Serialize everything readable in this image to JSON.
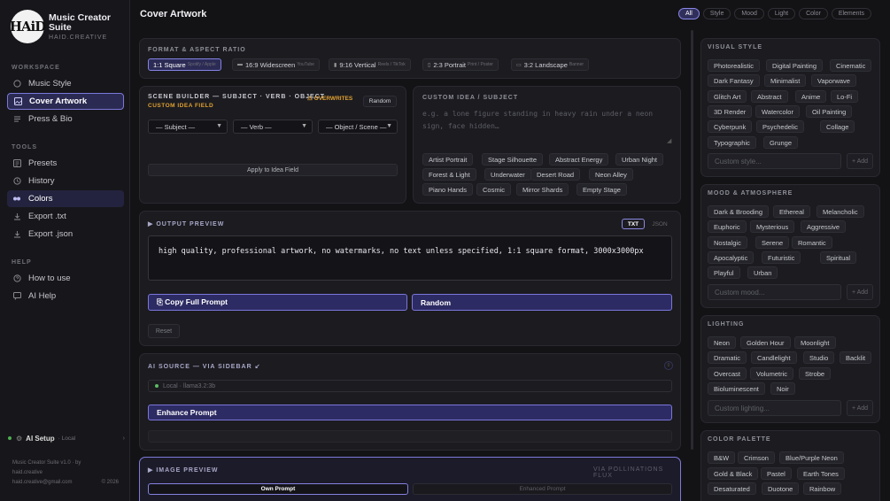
{
  "app": {
    "title": "Music Creator Suite",
    "sub": "HAID.CREATIVE",
    "logo_text": "HAiD"
  },
  "sidebar": {
    "workspace_label": "WORKSPACE",
    "workspace": [
      {
        "label": "Music Style",
        "icon": "circle-icon"
      },
      {
        "label": "Cover Artwork",
        "icon": "image-icon"
      },
      {
        "label": "Press & Bio",
        "icon": "lines-icon"
      }
    ],
    "tools_label": "TOOLS",
    "tools": [
      {
        "label": "Presets",
        "icon": "preset-icon"
      },
      {
        "label": "History",
        "icon": "clock-icon"
      },
      {
        "label": "Colors",
        "icon": "palette-icon"
      },
      {
        "label": "Export .txt",
        "icon": "download-icon"
      },
      {
        "label": "Export .json",
        "icon": "download-icon"
      }
    ],
    "help_label": "HELP",
    "help": [
      {
        "label": "How to use",
        "icon": "help-icon"
      },
      {
        "label": "AI Help",
        "icon": "chat-icon"
      }
    ],
    "ai_setup": {
      "label": "AI Setup",
      "mode": "· Local"
    },
    "footer": {
      "line1": "Music Creator Suite v1.0 · by",
      "line2": "haid.creative",
      "line3": "haid.creative@gmail.com",
      "year": "© 2026"
    }
  },
  "header": {
    "title": "Cover Artwork",
    "filters": [
      "All",
      "Style",
      "Mood",
      "Light",
      "Color",
      "Elements"
    ]
  },
  "format": {
    "label": "FORMAT & ASPECT RATIO",
    "options": [
      {
        "label": "1:1 Square",
        "sub": "Spotify / Apple",
        "glyph": ""
      },
      {
        "label": "16:9 Widescreen",
        "sub": "YouTube",
        "glyph": "▬"
      },
      {
        "label": "9:16 Vertical",
        "sub": "Reels / TikTok",
        "glyph": "▮"
      },
      {
        "label": "2:3 Portrait",
        "sub": "Print / Poster",
        "glyph": "▯"
      },
      {
        "label": "3:2 Landscape",
        "sub": "Banner",
        "glyph": "▭"
      }
    ]
  },
  "scene": {
    "label": "SCENE BUILDER — SUBJECT · VERB · OBJECT",
    "warn": "⚠ OVERWRITES",
    "warn2": "CUSTOM IDEA FIELD",
    "random": "Random",
    "subject": "— Subject —",
    "verb": "— Verb —",
    "object": "— Object / Scene —",
    "apply": "Apply to Idea Field"
  },
  "custom_idea": {
    "label": "CUSTOM IDEA / SUBJECT",
    "placeholder": "e.g. a lone figure standing in heavy rain under a neon sign, face hidden…",
    "chips": [
      "Artist Portrait",
      "Stage Silhouette",
      "Abstract Energy",
      "Urban Night",
      "Forest & Light",
      "Underwater",
      "Desert Road",
      "Neon Alley",
      "Piano Hands",
      "Cosmic",
      "Mirror Shards",
      "Empty Stage"
    ]
  },
  "output": {
    "label": "▶ OUTPUT PREVIEW",
    "txt": "TXT",
    "json": "JSON",
    "text": "high quality, professional artwork, no watermarks, no text unless specified, 1:1 square format, 3000x3000px",
    "copy": "⎘ Copy Full Prompt",
    "random": "Random",
    "reset": "Reset"
  },
  "ai_source": {
    "label": "AI SOURCE — VIA SIDEBAR ↙",
    "model": "Local · llama3.2:3b",
    "enhance": "Enhance Prompt",
    "count": "0"
  },
  "image_preview": {
    "label": "▶ IMAGE PREVIEW",
    "via": "VIA POLLINATIONS FLUX",
    "own": "Own Prompt",
    "enhanced": "Enhanced Prompt"
  },
  "right": {
    "visual": {
      "label": "VISUAL STYLE",
      "chips": [
        "Photorealistic",
        "Digital Painting",
        "Cinematic",
        "Dark Fantasy",
        "Minimalist",
        "Vaporwave",
        "Glitch Art",
        "Abstract",
        "Anime",
        "Lo-Fi",
        "3D Render",
        "Watercolor",
        "Oil Painting",
        "Cyberpunk",
        "Psychedelic",
        "Collage",
        "Typographic",
        "Grunge"
      ],
      "placeholder": "Custom style...",
      "add": "+ Add"
    },
    "mood": {
      "label": "MOOD & ATMOSPHERE",
      "chips": [
        "Dark & Brooding",
        "Ethereal",
        "Melancholic",
        "Euphoric",
        "Mysterious",
        "Aggressive",
        "Nostalgic",
        "Serene",
        "Romantic",
        "Apocalyptic",
        "Futuristic",
        "Spiritual",
        "Playful",
        "Urban"
      ],
      "placeholder": "Custom mood...",
      "add": "+ Add"
    },
    "lighting": {
      "label": "LIGHTING",
      "chips": [
        "Neon",
        "Golden Hour",
        "Moonlight",
        "Dramatic",
        "Candlelight",
        "Studio",
        "Backlit",
        "Overcast",
        "Volumetric",
        "Strobe",
        "Bioluminescent",
        "Noir"
      ],
      "placeholder": "Custom lighting...",
      "add": "+ Add"
    },
    "palette": {
      "label": "COLOR PALETTE",
      "chips": [
        "B&W",
        "Crimson",
        "Blue/Purple Neon",
        "Gold & Black",
        "Pastel",
        "Earth Tones",
        "Desaturated",
        "Duotone",
        "Rainbow"
      ]
    }
  },
  "colors": {
    "accent": "#8582e2",
    "accent_bg": "#2c2b55",
    "warn": "#e0a030",
    "bg": "#131316"
  }
}
